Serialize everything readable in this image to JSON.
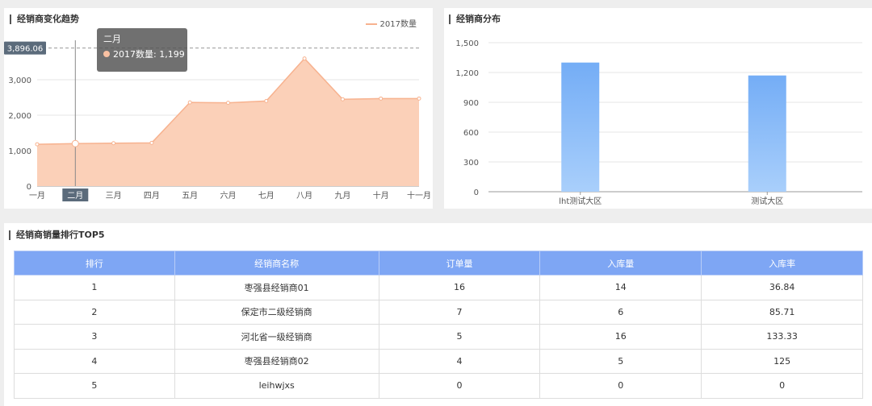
{
  "trend_panel": {
    "title": "经销商变化趋势",
    "legend_label": "2017数量",
    "crosshair_value": "3,896.06",
    "tooltip": {
      "month": "二月",
      "series": "2017数量",
      "value": "1,199"
    }
  },
  "dist_panel": {
    "title": "经销商分布"
  },
  "rank_panel": {
    "title": "经销商销量排行TOP5",
    "columns": [
      "排行",
      "经销商名称",
      "订单量",
      "入库量",
      "入库率"
    ],
    "rows": [
      [
        "1",
        "枣强县经销商01",
        "16",
        "14",
        "36.84"
      ],
      [
        "2",
        "保定市二级经销商",
        "7",
        "6",
        "85.71"
      ],
      [
        "3",
        "河北省一级经销商",
        "5",
        "16",
        "133.33"
      ],
      [
        "4",
        "枣强县经销商02",
        "4",
        "5",
        "125"
      ],
      [
        "5",
        "leihwjxs",
        "0",
        "0",
        "0"
      ]
    ]
  },
  "colors": {
    "area_fill": "#fbd0b8",
    "area_line": "#f7b28f",
    "bar_top": "#74adf6",
    "bar_bottom": "#a9cffb",
    "header": "#7ea6f4"
  },
  "chart_data": [
    {
      "type": "area",
      "title": "经销商变化趋势",
      "categories": [
        "一月",
        "二月",
        "三月",
        "四月",
        "五月",
        "六月",
        "七月",
        "八月",
        "九月",
        "十月",
        "十一月"
      ],
      "series": [
        {
          "name": "2017数量",
          "values": [
            1180,
            1199,
            1210,
            1220,
            2360,
            2350,
            2400,
            3600,
            2450,
            2470,
            2470
          ]
        }
      ],
      "y_ticks": [
        "0",
        "1,000",
        "2,000",
        "3,000"
      ],
      "ylim": [
        0,
        4000
      ],
      "highlight_category": "二月",
      "crosshair_y": 3896.06,
      "grid": true,
      "legend_position": "top-right"
    },
    {
      "type": "bar",
      "title": "经销商分布",
      "categories": [
        "lht测试大区",
        "测试大区"
      ],
      "values": [
        1300,
        1170
      ],
      "y_ticks": [
        "0",
        "300",
        "600",
        "900",
        "1,200",
        "1,500"
      ],
      "ylim": [
        0,
        1500
      ],
      "grid": true
    }
  ]
}
